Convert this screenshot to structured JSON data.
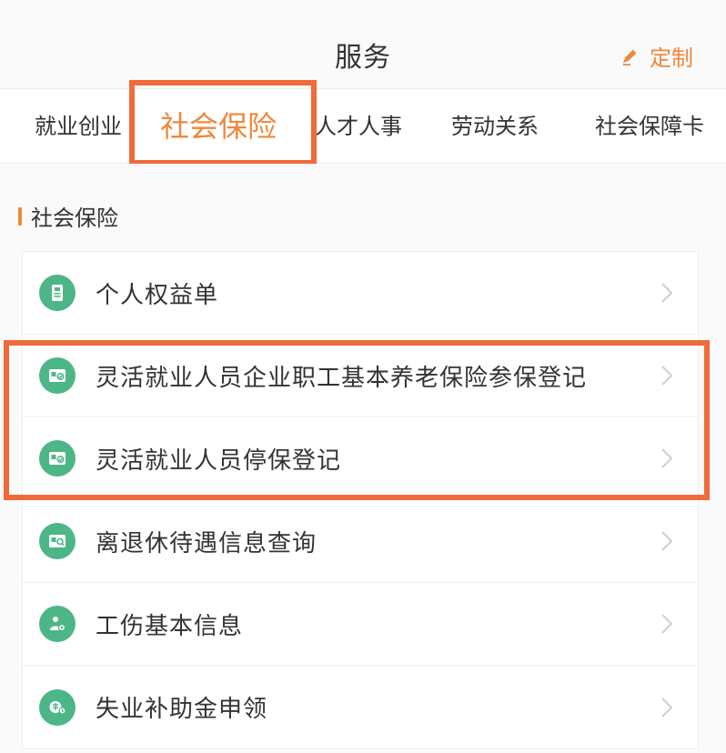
{
  "header": {
    "title": "服务",
    "customize_label": "定制"
  },
  "tabs": [
    {
      "label": "就业创业",
      "active": false
    },
    {
      "label": "社会保险",
      "active": true
    },
    {
      "label": "人才人事",
      "active": false
    },
    {
      "label": "劳动关系",
      "active": false
    },
    {
      "label": "社会保障卡",
      "active": false
    }
  ],
  "section": {
    "title": "社会保险",
    "items": [
      {
        "label": "个人权益单",
        "icon": "id-badge-icon"
      },
      {
        "label": "灵活就业人员企业职工基本养老保险参保登记",
        "icon": "card-check-icon"
      },
      {
        "label": "灵活就业人员停保登记",
        "icon": "card-check-icon"
      },
      {
        "label": "离退休待遇信息查询",
        "icon": "card-search-icon"
      },
      {
        "label": "工伤基本信息",
        "icon": "injury-icon"
      },
      {
        "label": "失业补助金申领",
        "icon": "unemployment-icon"
      }
    ]
  },
  "colors": {
    "accent": "#f0873a",
    "icon_bg": "#4db687",
    "annotation": "#f06a3a"
  }
}
